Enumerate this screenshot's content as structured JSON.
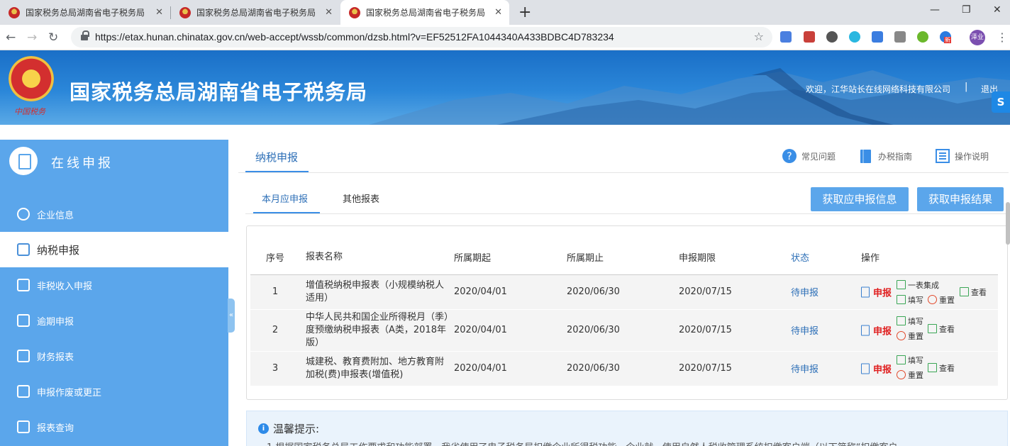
{
  "browser": {
    "tabs": [
      {
        "title": "国家税务总局湖南省电子税务局"
      },
      {
        "title": "国家税务总局湖南省电子税务局"
      },
      {
        "title": "国家税务总局湖南省电子税务局"
      }
    ],
    "url": "https://etax.hunan.chinatax.gov.cn/web-accept/wssb/common/dzsb.html?v=EF52512FA1044340A433BDBC4D783234",
    "profile_label": "泽业",
    "ext_badge": "新"
  },
  "header": {
    "site_title": "国家税务总局湖南省电子税务局",
    "emblem_text": "中国税务",
    "welcome": "欢迎，江华站长在线网络科技有限公司",
    "separator": "|",
    "logout": "退出"
  },
  "sidebar": {
    "title": "在线申报",
    "items": [
      {
        "label": "企业信息"
      },
      {
        "label": "纳税申报"
      },
      {
        "label": "非税收入申报"
      },
      {
        "label": "逾期申报"
      },
      {
        "label": "财务报表"
      },
      {
        "label": "申报作废或更正"
      },
      {
        "label": "报表查询"
      }
    ],
    "collapse_label": "«"
  },
  "main": {
    "page_tab": "纳税申报",
    "help_links": [
      {
        "label": "常见问题"
      },
      {
        "label": "办税指南"
      },
      {
        "label": "操作说明"
      }
    ],
    "sub_tabs": [
      {
        "label": "本月应申报"
      },
      {
        "label": "其他报表"
      }
    ],
    "buttons": {
      "fetch_info": "获取应申报信息",
      "fetch_result": "获取申报结果"
    },
    "table": {
      "headers": [
        "序号",
        "报表名称",
        "所属期起",
        "所属期止",
        "申报期限",
        "状态",
        "操作"
      ],
      "rows": [
        {
          "seq": "1",
          "name": "增值税纳税申报表（小规模纳税人适用）",
          "start": "2020/04/01",
          "end": "2020/06/30",
          "due": "2020/07/15",
          "status": "待申报"
        },
        {
          "seq": "2",
          "name": "中华人民共和国企业所得税月（季）度预缴纳税申报表（A类，2018年版）",
          "start": "2020/04/01",
          "end": "2020/06/30",
          "due": "2020/07/15",
          "status": "待申报"
        },
        {
          "seq": "3",
          "name": "城建税、教育费附加、地方教育附加税(费)申报表(增值税)",
          "start": "2020/04/01",
          "end": "2020/06/30",
          "due": "2020/07/15",
          "status": "待申报"
        }
      ],
      "op_labels": {
        "declare": "申报",
        "integrate": "一表集成",
        "fill": "填写",
        "reset": "重置",
        "view": "查看"
      }
    },
    "tips": {
      "title": "温馨提示:",
      "body": "1.根据国家税务总局工作要求和功能部署，我省使用了电子税务局扣缴企业所得税功能，企业就...使用自然人税收管理系统扣缴客户端（以下简称“扣缴客户"
    }
  }
}
